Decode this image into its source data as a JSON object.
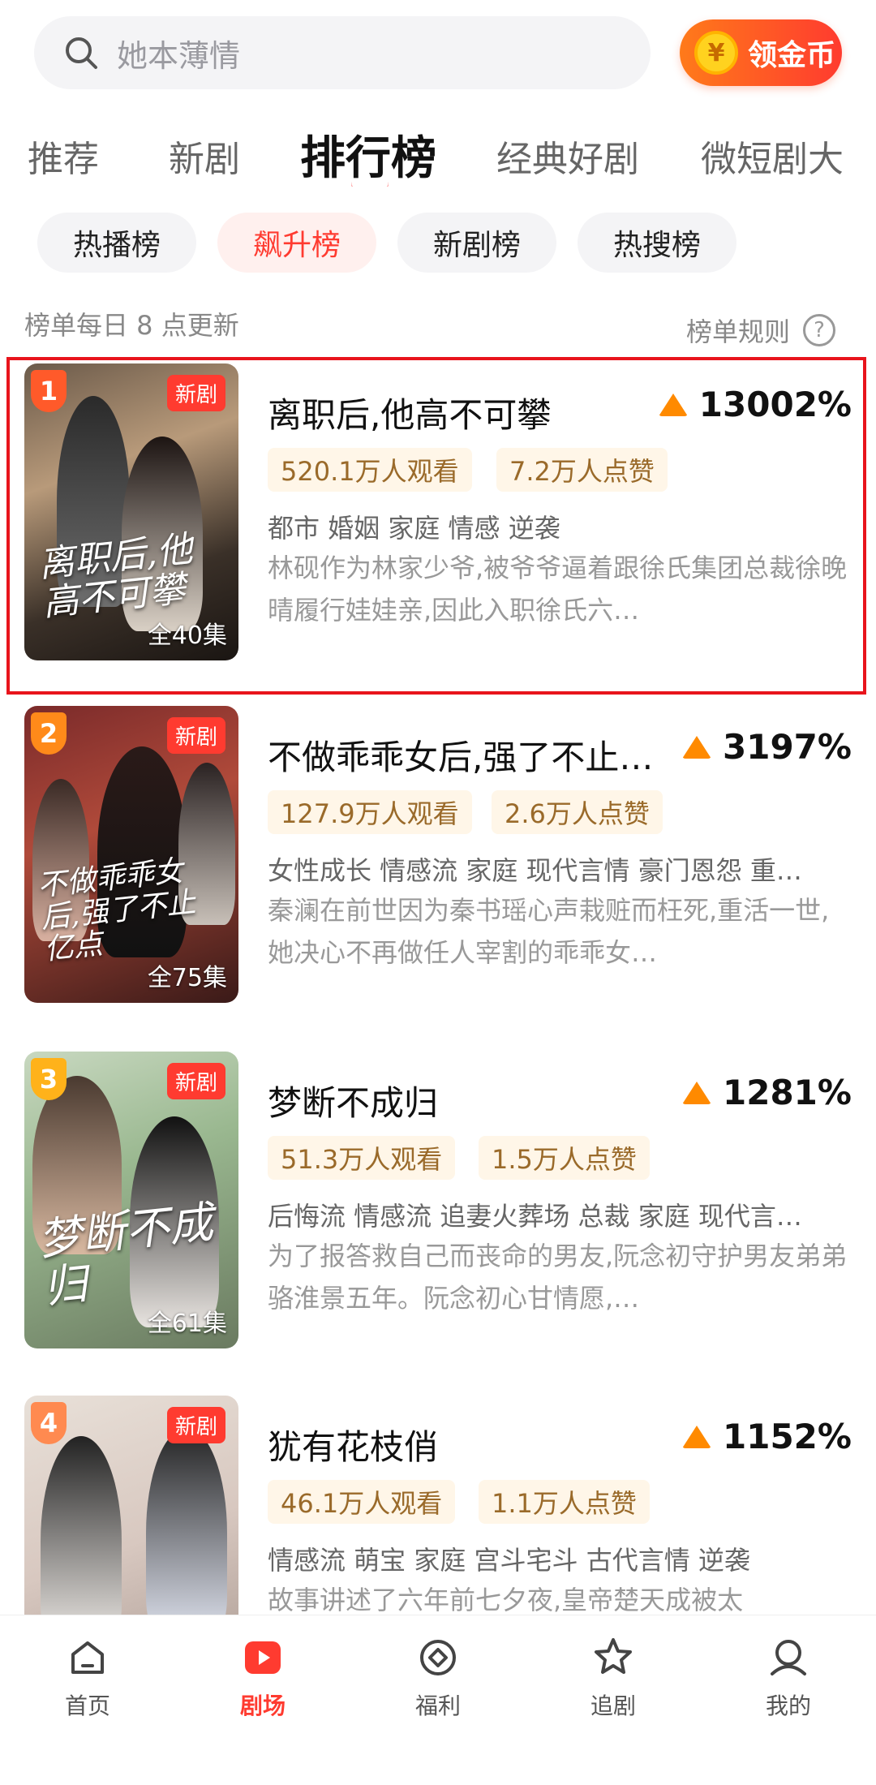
{
  "search": {
    "placeholder": "她本薄情"
  },
  "coin_button": {
    "label": "领金币",
    "icon_glyph": "¥"
  },
  "tabs": [
    {
      "label": "推荐"
    },
    {
      "label": "新剧"
    },
    {
      "label": "排行榜",
      "active": true
    },
    {
      "label": "经典好剧"
    },
    {
      "label": "微短剧大"
    }
  ],
  "subtabs": [
    {
      "label": "热播榜"
    },
    {
      "label": "飙升榜",
      "active": true
    },
    {
      "label": "新剧榜"
    },
    {
      "label": "热搜榜"
    }
  ],
  "update_note": "榜单每日 8 点更新",
  "rules_label": "榜单规则",
  "rules_icon": "?",
  "items": [
    {
      "rank": "1",
      "badge_color": "#ff5a2a",
      "new_tag": "新剧",
      "episodes": "全40集",
      "poster_text": "离职后,他高不可攀",
      "title": "离职后,他高不可攀",
      "trend": "13002%",
      "views": "520.1万人观看",
      "likes": "7.2万人点赞",
      "tags": "都市 婚姻 家庭 情感 逆袭",
      "desc": "林砚作为林家少爷,被爷爷逼着跟徐氏集团总裁徐晚晴履行娃娃亲,因此入职徐氏六…"
    },
    {
      "rank": "2",
      "badge_color": "#ff8a1a",
      "new_tag": "新剧",
      "episodes": "全75集",
      "poster_text": "不做乖乖女后,强了不止亿点",
      "title": "不做乖乖女后,强了不止…",
      "trend": "3197%",
      "views": "127.9万人观看",
      "likes": "2.6万人点赞",
      "tags": "女性成长 情感流 家庭 现代言情 豪门恩怨 重…",
      "desc": "秦澜在前世因为秦书瑶心声栽赃而枉死,重活一世,她决心不再做任人宰割的乖乖女…"
    },
    {
      "rank": "3",
      "badge_color": "#ffb21a",
      "new_tag": "新剧",
      "episodes": "全61集",
      "poster_text": "梦断不成归",
      "title": "梦断不成归",
      "trend": "1281%",
      "views": "51.3万人观看",
      "likes": "1.5万人点赞",
      "tags": "后悔流 情感流 追妻火葬场 总裁 家庭 现代言…",
      "desc": "为了报答救自己而丧命的男友,阮念初守护男友弟弟骆淮景五年。阮念初心甘情愿,…"
    },
    {
      "rank": "4",
      "badge_color": "#ff8a50",
      "new_tag": "新剧",
      "episodes": "",
      "poster_text": "",
      "title": "犹有花枝俏",
      "trend": "1152%",
      "views": "46.1万人观看",
      "likes": "1.1万人点赞",
      "tags": "情感流 萌宝 家庭 宫斗宅斗 古代言情 逆袭",
      "desc": "故事讲述了六年前七夕夜,皇帝楚天成被太"
    }
  ],
  "bottom_nav": [
    {
      "label": "首页",
      "icon": "home-icon"
    },
    {
      "label": "剧场",
      "icon": "play-icon",
      "active": true
    },
    {
      "label": "福利",
      "icon": "gift-diamond-icon"
    },
    {
      "label": "追剧",
      "icon": "star-icon"
    },
    {
      "label": "我的",
      "icon": "profile-icon"
    }
  ],
  "colors": {
    "accent": "#ff3b30",
    "trend_arrow": "#ff8a00",
    "stat_bg": "#fff6e8"
  }
}
